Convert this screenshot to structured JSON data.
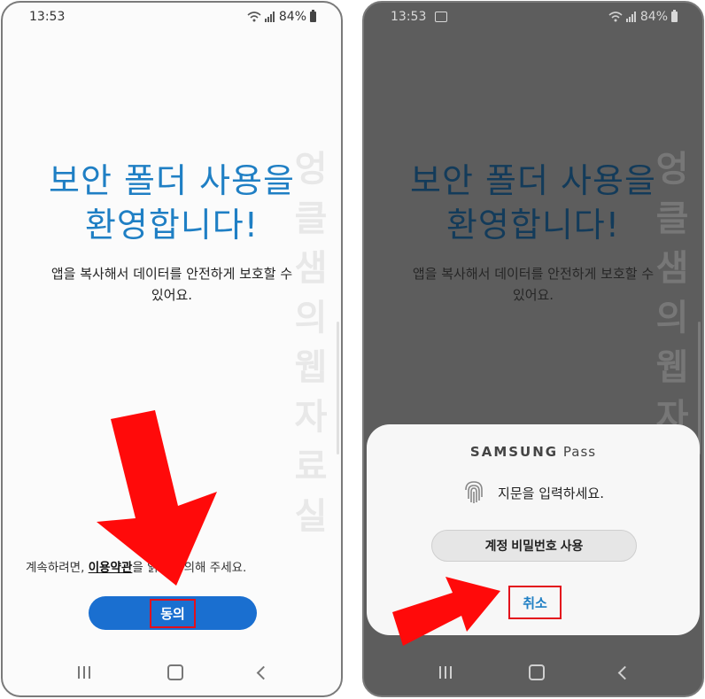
{
  "left_screen": {
    "status": {
      "time": "13:53",
      "battery": "84%"
    },
    "title_line1": "보안 폴더 사용을",
    "title_line2": "환영합니다!",
    "subtitle_line1": "앱을 복사해서 데이터를 안전하게 보호할 수",
    "subtitle_line2": "있어요.",
    "terms_prefix": "계속하려면, ",
    "terms_link": "이용약관",
    "terms_suffix": "을 읽고 동의해 주세요.",
    "agree_button": "동의"
  },
  "right_screen": {
    "status": {
      "time": "13:53",
      "battery": "84%"
    },
    "title_line1": "보안 폴더 사용을",
    "title_line2": "환영합니다!",
    "subtitle_line1": "앱을 복사해서 데이터를 안전하게 보호할 수",
    "subtitle_line2": "있어요.",
    "dialog": {
      "brand_bold": "SAMSUNG",
      "brand_rest": " Pass",
      "fingerprint_prompt": "지문을 입력하세요.",
      "password_button": "계정 비밀번호 사용",
      "cancel_button": "취소"
    }
  },
  "watermark": "엉클샘의웹자료실",
  "colors": {
    "accent": "#1f7fc4",
    "button_blue": "#1a6fd0",
    "highlight_red": "#e3101c",
    "arrow_red": "#ff0a0a",
    "dim_overlay": "#5d5d5d"
  },
  "icons": [
    "wifi-icon",
    "signal-icon",
    "battery-icon",
    "gallery-icon",
    "fingerprint-icon",
    "recent-apps-icon",
    "home-icon",
    "back-icon",
    "red-arrow-icon"
  ]
}
